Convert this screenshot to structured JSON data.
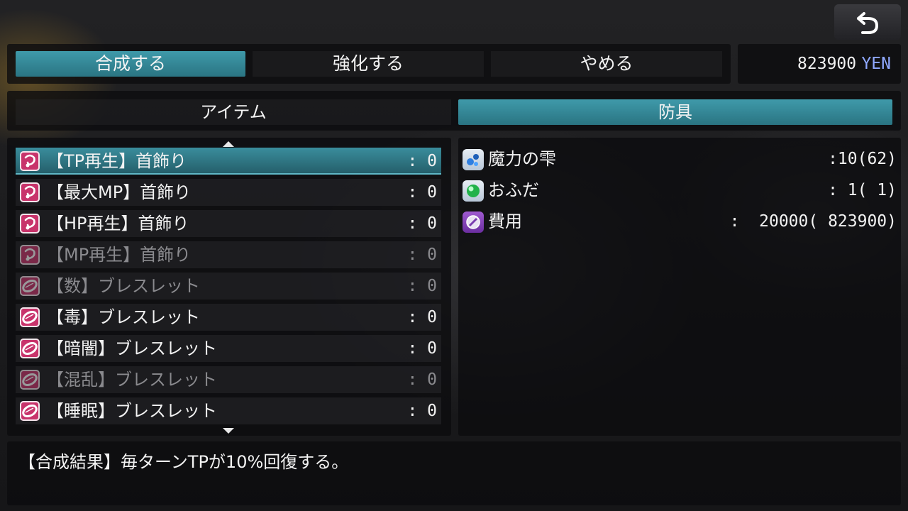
{
  "commands": [
    {
      "label": "合成する",
      "active": true
    },
    {
      "label": "強化する",
      "active": false
    },
    {
      "label": "やめる",
      "active": false
    }
  ],
  "money": {
    "amount": "823900",
    "unit": "YEN"
  },
  "tabs": [
    {
      "label": "アイテム",
      "active": false
    },
    {
      "label": "防具",
      "active": true
    }
  ],
  "items": [
    {
      "name": "【TP再生】首飾り",
      "count": ": 0",
      "icon": "necklace-icon",
      "enabled": true,
      "selected": true
    },
    {
      "name": "【最大MP】首飾り",
      "count": ": 0",
      "icon": "necklace-icon",
      "enabled": true,
      "selected": false
    },
    {
      "name": "【HP再生】首飾り",
      "count": ": 0",
      "icon": "necklace-icon",
      "enabled": true,
      "selected": false
    },
    {
      "name": "【MP再生】首飾り",
      "count": ": 0",
      "icon": "necklace-icon",
      "enabled": false,
      "selected": false
    },
    {
      "name": "【数】ブレスレット",
      "count": ": 0",
      "icon": "bracelet-icon",
      "enabled": false,
      "selected": false
    },
    {
      "name": "【毒】ブレスレット",
      "count": ": 0",
      "icon": "bracelet-icon",
      "enabled": true,
      "selected": false
    },
    {
      "name": "【暗闇】ブレスレット",
      "count": ": 0",
      "icon": "bracelet-icon",
      "enabled": true,
      "selected": false
    },
    {
      "name": "【混乱】ブレスレット",
      "count": ": 0",
      "icon": "bracelet-icon",
      "enabled": false,
      "selected": false
    },
    {
      "name": "【睡眠】ブレスレット",
      "count": ": 0",
      "icon": "bracelet-icon",
      "enabled": true,
      "selected": false
    }
  ],
  "materials": [
    {
      "name": "魔力の雫",
      "value": ":10(62)",
      "icon": "magic-drop-icon"
    },
    {
      "name": "おふだ",
      "value": ": 1( 1)",
      "icon": "green-orb-icon"
    },
    {
      "name": "費用",
      "value": ":  20000( 823900)",
      "icon": "coin-icon"
    }
  ],
  "description": "【合成結果】毎ターンTPが10%回復する。",
  "colors": {
    "accent": "#3f9aaa",
    "yen": "#8fa8ff",
    "item_icon": "#c8336b"
  }
}
